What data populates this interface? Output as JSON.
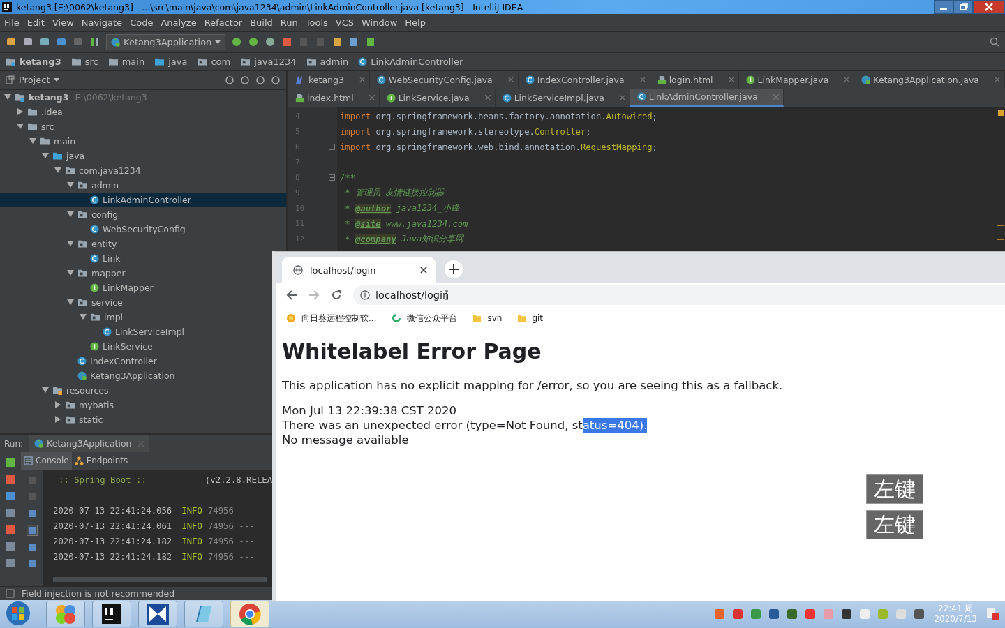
{
  "window": {
    "title": "ketang3 [E:\\0062\\ketang3] - ...\\src\\main\\java\\com\\java1234\\admin\\LinkAdminController.java [ketang3] - IntelliJ IDEA"
  },
  "menu": [
    "File",
    "Edit",
    "View",
    "Navigate",
    "Code",
    "Analyze",
    "Refactor",
    "Build",
    "Run",
    "Tools",
    "VCS",
    "Window",
    "Help"
  ],
  "toolbar": {
    "run_config": "Ketang3Application"
  },
  "breadcrumbs": [
    {
      "label": "ketang3",
      "kind": "module"
    },
    {
      "label": "src",
      "kind": "folder"
    },
    {
      "label": "main",
      "kind": "folder"
    },
    {
      "label": "java",
      "kind": "source"
    },
    {
      "label": "com",
      "kind": "package"
    },
    {
      "label": "java1234",
      "kind": "package"
    },
    {
      "label": "admin",
      "kind": "package"
    },
    {
      "label": "LinkAdminController",
      "kind": "class"
    }
  ],
  "project_panel": {
    "title": "Project",
    "tree": [
      {
        "label": "ketang3",
        "path": "E:\\0062\\ketang3",
        "kind": "module",
        "expanded": true,
        "selected": false,
        "children": [
          {
            "label": ".idea",
            "kind": "folder",
            "expanded": false,
            "selected": false
          },
          {
            "label": "src",
            "kind": "folder",
            "expanded": true,
            "selected": false,
            "children": [
              {
                "label": "main",
                "kind": "folder",
                "expanded": true,
                "selected": false,
                "children": [
                  {
                    "label": "java",
                    "kind": "source",
                    "expanded": true,
                    "selected": false,
                    "children": [
                      {
                        "label": "com.java1234",
                        "kind": "package",
                        "expanded": true,
                        "selected": false,
                        "children": [
                          {
                            "label": "admin",
                            "kind": "package",
                            "expanded": true,
                            "selected": false,
                            "children": [
                              {
                                "label": "LinkAdminController",
                                "kind": "class",
                                "selected": true
                              }
                            ]
                          },
                          {
                            "label": "config",
                            "kind": "package",
                            "expanded": true,
                            "selected": false,
                            "children": [
                              {
                                "label": "WebSecurityConfig",
                                "kind": "class",
                                "selected": false
                              }
                            ]
                          },
                          {
                            "label": "entity",
                            "kind": "package",
                            "expanded": true,
                            "selected": false,
                            "children": [
                              {
                                "label": "Link",
                                "kind": "class",
                                "selected": false
                              }
                            ]
                          },
                          {
                            "label": "mapper",
                            "kind": "package",
                            "expanded": true,
                            "selected": false,
                            "children": [
                              {
                                "label": "LinkMapper",
                                "kind": "interface",
                                "selected": false
                              }
                            ]
                          },
                          {
                            "label": "service",
                            "kind": "package",
                            "expanded": true,
                            "selected": false,
                            "children": [
                              {
                                "label": "impl",
                                "kind": "package",
                                "expanded": true,
                                "selected": false,
                                "children": [
                                  {
                                    "label": "LinkServiceImpl",
                                    "kind": "class",
                                    "selected": false
                                  }
                                ]
                              },
                              {
                                "label": "LinkService",
                                "kind": "interface",
                                "selected": false
                              }
                            ]
                          },
                          {
                            "label": "IndexController",
                            "kind": "class",
                            "selected": false
                          },
                          {
                            "label": "Ketang3Application",
                            "kind": "app",
                            "selected": false
                          }
                        ]
                      }
                    ]
                  },
                  {
                    "label": "resources",
                    "kind": "resources",
                    "expanded": true,
                    "selected": false,
                    "children": [
                      {
                        "label": "mybatis",
                        "kind": "package",
                        "expanded": false,
                        "selected": false
                      },
                      {
                        "label": "static",
                        "kind": "package",
                        "expanded": false,
                        "selected": false
                      }
                    ]
                  }
                ]
              }
            ]
          }
        ]
      }
    ]
  },
  "editor_tab_rows": [
    {
      "tabs": [
        {
          "label": "ketang3",
          "kind": "maven",
          "selected": false
        },
        {
          "label": "WebSecurityConfig.java",
          "kind": "class",
          "selected": false
        },
        {
          "label": "IndexController.java",
          "kind": "class",
          "selected": false
        },
        {
          "label": "login.html",
          "kind": "html",
          "selected": false
        },
        {
          "label": "LinkMapper.java",
          "kind": "interface",
          "selected": false
        },
        {
          "label": "Ketang3Application.java",
          "kind": "app",
          "selected": false
        }
      ]
    },
    {
      "tabs": [
        {
          "label": "index.html",
          "kind": "html",
          "selected": false
        },
        {
          "label": "LinkService.java",
          "kind": "interface",
          "selected": false
        },
        {
          "label": "LinkServiceImpl.java",
          "kind": "class",
          "selected": false
        },
        {
          "label": "LinkAdminController.java",
          "kind": "class",
          "selected": true
        }
      ]
    }
  ],
  "code_lines": [
    {
      "number": "4",
      "fold": false,
      "tokens": [
        {
          "kind": "keyword",
          "text": "import "
        },
        {
          "kind": "text",
          "text": "org.springframework.beans.factory.annotation."
        },
        {
          "kind": "type",
          "text": "Autowired"
        },
        {
          "kind": "text",
          "text": ";"
        }
      ]
    },
    {
      "number": "5",
      "fold": false,
      "tokens": [
        {
          "kind": "keyword",
          "text": "import "
        },
        {
          "kind": "text",
          "text": "org.springframework.stereotype."
        },
        {
          "kind": "type",
          "text": "Controller"
        },
        {
          "kind": "text",
          "text": ";"
        }
      ]
    },
    {
      "number": "6",
      "fold": true,
      "tokens": [
        {
          "kind": "keyword",
          "text": "import "
        },
        {
          "kind": "text",
          "text": "org.springframework.web.bind.annotation."
        },
        {
          "kind": "type",
          "text": "RequestMapping"
        },
        {
          "kind": "text",
          "text": ";"
        }
      ]
    },
    {
      "number": "7",
      "fold": false
    },
    {
      "number": "8",
      "fold": true,
      "tokens": [
        {
          "kind": "comment",
          "text": "/**"
        }
      ]
    },
    {
      "number": "9",
      "fold": false,
      "tokens": [
        {
          "kind": "comment",
          "text": " * 管理员-友情链接控制器"
        }
      ]
    },
    {
      "number": "10",
      "fold": false,
      "tokens": [
        {
          "kind": "comment",
          "text": " * "
        },
        {
          "kind": "doctag",
          "text": "@author"
        },
        {
          "kind": "comment",
          "text": " java1234_小锋"
        }
      ]
    },
    {
      "number": "11",
      "fold": false,
      "tokens": [
        {
          "kind": "comment",
          "text": " * "
        },
        {
          "kind": "doctag",
          "text": "@site"
        },
        {
          "kind": "comment",
          "text": " www.java1234.com"
        }
      ]
    },
    {
      "number": "12",
      "fold": false,
      "tokens": [
        {
          "kind": "comment",
          "text": " * "
        },
        {
          "kind": "doctag",
          "text": "@company"
        },
        {
          "kind": "comment",
          "text": " Java知识分享网"
        }
      ]
    }
  ],
  "run_panel": {
    "label": "Run:",
    "config": "Ketang3Application",
    "tabs": [
      {
        "label": "Console",
        "kind": "console",
        "selected": true
      },
      {
        "label": "Endpoints",
        "kind": "endpoints",
        "selected": false
      }
    ],
    "console_lines": [
      {
        "kind": "banner",
        "text": ":: Spring Boot ::",
        "version": "(v2.2.8.RELEA"
      },
      {
        "kind": "blank"
      },
      {
        "kind": "log",
        "timestamp": "2020-07-13 22:41:24.056",
        "level": "INFO",
        "rest": "74956 ---"
      },
      {
        "kind": "log",
        "timestamp": "2020-07-13 22:41:24.061",
        "level": "INFO",
        "rest": "74956 ---"
      },
      {
        "kind": "log",
        "timestamp": "2020-07-13 22:41:24.182",
        "level": "INFO",
        "rest": "74956 ---"
      },
      {
        "kind": "log",
        "timestamp": "2020-07-13 22:41:24.182",
        "level": "INFO",
        "rest": "74956 ---"
      }
    ]
  },
  "status_bar": {
    "message": "Field injection is not recommended"
  },
  "browser": {
    "tab_title": "localhost/login",
    "url": "localhost/login",
    "bookmarks": [
      {
        "label": "向日葵远程控制软...",
        "kind": "sun"
      },
      {
        "label": "微信公众平台",
        "kind": "wechat"
      },
      {
        "label": "svn",
        "kind": "folder"
      },
      {
        "label": "git",
        "kind": "folder"
      }
    ],
    "page": {
      "heading": "Whitelabel Error Page",
      "message": "This application has no explicit mapping for /error, so you are seeing this as a fallback.",
      "timestamp": "Mon Jul 13 22:39:38 CST 2020",
      "error": {
        "text": "There was an unexpected error (type=Not Found, st",
        "selected_text": "atus=404)."
      },
      "detail": "No message available"
    }
  },
  "key_overlays": [
    "左键",
    "左键"
  ],
  "taskbar": {
    "apps": [
      {
        "kind": "app",
        "selected": false
      },
      {
        "kind": "ide",
        "selected": false
      },
      {
        "kind": "editor",
        "selected": false
      },
      {
        "kind": "window",
        "selected": false
      },
      {
        "kind": "chrome",
        "selected": true
      }
    ],
    "clock": {
      "time": "22:41 周",
      "date": "2020/7/13"
    }
  }
}
